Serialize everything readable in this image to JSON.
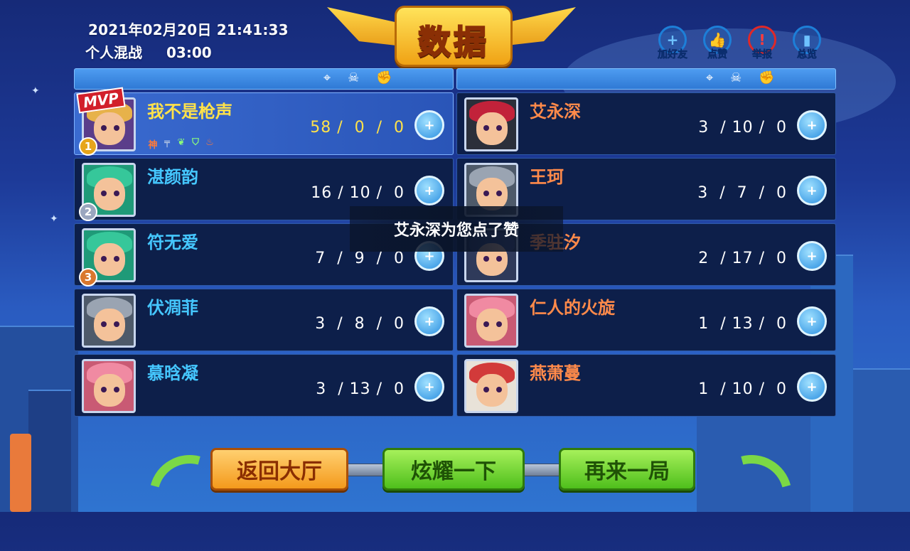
{
  "header": {
    "datetime": "2021年02月20日 21:41:33",
    "mode": "个人混战",
    "duration": "03:00",
    "title": "数据"
  },
  "actions": [
    {
      "label": "加好友",
      "icon": "add-friend-icon"
    },
    {
      "label": "点赞",
      "icon": "thumbs-up-icon"
    },
    {
      "label": "举报",
      "icon": "warning-icon"
    },
    {
      "label": "总览",
      "icon": "bar-chart-icon"
    }
  ],
  "team_header_icons": [
    "crosshair-icon",
    "skull-icon",
    "fist-icon"
  ],
  "left_team": [
    {
      "name": "我不是枪声",
      "kda": "58 /  0  /  0",
      "rank": "1",
      "mvp": "MVP",
      "badges": [
        "神"
      ]
    },
    {
      "name": "湛颜韵",
      "kda": "16 / 10 /  0",
      "rank": "2"
    },
    {
      "name": "符无爱",
      "kda": "7  /  9  /  0",
      "rank": "3"
    },
    {
      "name": "伏凋菲",
      "kda": "3  /  8  /  0"
    },
    {
      "name": "慕晗凝",
      "kda": "3  / 13 /  0"
    }
  ],
  "right_team": [
    {
      "name": "艾永深",
      "kda": "3  / 10 /  0"
    },
    {
      "name": "王珂",
      "kda": "3  /  7  /  0"
    },
    {
      "name": "季驻汐",
      "kda": "2  / 17 /  0"
    },
    {
      "name": "仁人的火旋",
      "kda": "1  / 13 /  0"
    },
    {
      "name": "燕萧蔓",
      "kda": "1  / 10 /  0"
    }
  ],
  "toast": "艾永深为您点了赞",
  "buttons": {
    "back": "返回大厅",
    "show_off": "炫耀一下",
    "again": "再来一局"
  },
  "colors": {
    "mvp_yellow": "#ffe24a",
    "left_name": "#45c7ff",
    "right_name": "#ff8a4a",
    "report_red": "#e02828"
  }
}
